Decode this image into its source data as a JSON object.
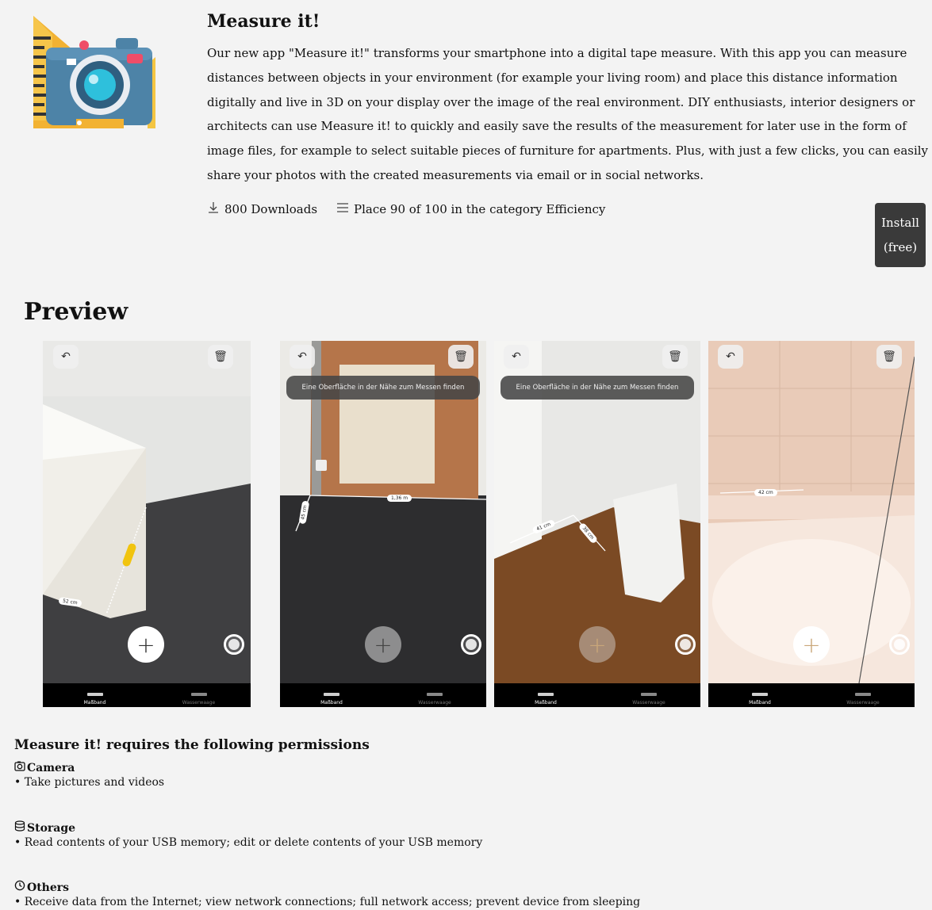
{
  "app": {
    "title": "Measure it!",
    "description": "Our new app \"Measure it!\" transforms your smartphone into a digital tape measure. With this app you can measure distances between objects in your environment (for example your living room) and place this distance information digitally and live in 3D on your display over the image of the real environment. DIY enthusiasts, interior designers or architects can use Measure it! to quickly and easily save the results of the measurement for later use in the form of image files, for example to select suitable pieces of furniture for apartments. Plus, with just a few clicks, you can easily share your photos with the created measurements via email or in social networks.",
    "downloads_icon": "download-icon",
    "downloads_text": "800 Downloads",
    "rank_icon": "list-icon",
    "rank_text": "Place 90 of 100 in the category Efficiency",
    "install_line1": "Install",
    "install_line2": "(free)",
    "icon": "camera-ruler-icon",
    "colors": {
      "install_bg": "#3a3a3a",
      "page_bg": "#f3f3f3"
    }
  },
  "preview": {
    "title": "Preview",
    "hint_text": "Eine Oberfläche in der Nähe zum Messen finden",
    "tab_left": "Maßband",
    "tab_right": "Wasserwaage",
    "undo_icon": "undo-icon",
    "trash_icon": "trash-icon",
    "plus_icon": "plus-icon",
    "screens": [
      {
        "labels": [
          "52 cm"
        ]
      },
      {
        "labels": [
          "1,36 m",
          "45 cm"
        ]
      },
      {
        "labels": [
          "41 cm",
          "38 cm"
        ]
      },
      {
        "labels": [
          "42 cm"
        ]
      }
    ]
  },
  "permissions": {
    "heading": "Measure it! requires the following permissions",
    "groups": [
      {
        "icon": "camera-icon",
        "title": "Camera",
        "items": [
          "Take pictures and videos"
        ]
      },
      {
        "icon": "database-icon",
        "title": "Storage",
        "items": [
          "Read contents of your USB memory; edit or delete contents of your USB memory"
        ]
      },
      {
        "icon": "clock-icon",
        "title": "Others",
        "items": [
          "Receive data from the Internet; view network connections; full network access; prevent device from sleeping"
        ]
      }
    ]
  }
}
